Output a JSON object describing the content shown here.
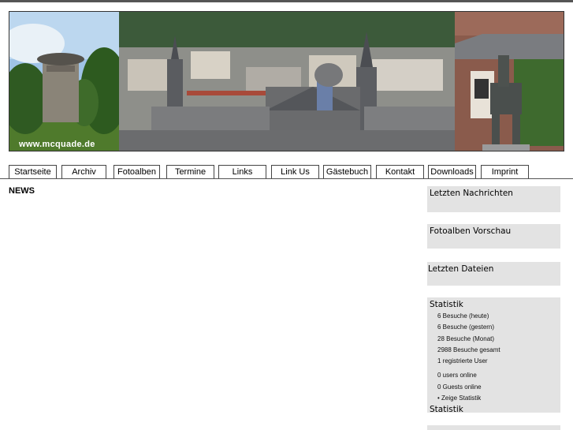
{
  "banner": {
    "url_text": "www.mcquade.de"
  },
  "nav": {
    "items": [
      {
        "label": "Startseite"
      },
      {
        "label": "Archiv"
      },
      {
        "label": "Fotoalben"
      },
      {
        "label": "Termine"
      },
      {
        "label": "Links"
      },
      {
        "label": "Link Us"
      },
      {
        "label": "Gästebuch"
      },
      {
        "label": "Kontakt"
      },
      {
        "label": "Downloads"
      },
      {
        "label": "Imprint"
      }
    ]
  },
  "main": {
    "title": "NEWS"
  },
  "sidebar": {
    "latest_news": "Letzten Nachrichten",
    "photo_preview": "Fotoalben Vorschau",
    "latest_files": "Letzten Dateien",
    "stats": {
      "title": "Statistik",
      "today": "6 Besuche (heute)",
      "yesterday": "6 Besuche (gestern)",
      "month": "28 Besuche (Monat)",
      "total": "2988 Besuche gesamt",
      "users": "1 registrierte User",
      "users_online_prefix": "0 users ",
      "users_online_suffix": "online",
      "guests_online_prefix": "0 Guests ",
      "guests_online_suffix": "online",
      "show_stats": "• Zeige Statistik",
      "footer_title": "Statistik"
    }
  },
  "colors": {
    "sidebar_box": "#e3e3e3",
    "nav_border": "#444444"
  }
}
